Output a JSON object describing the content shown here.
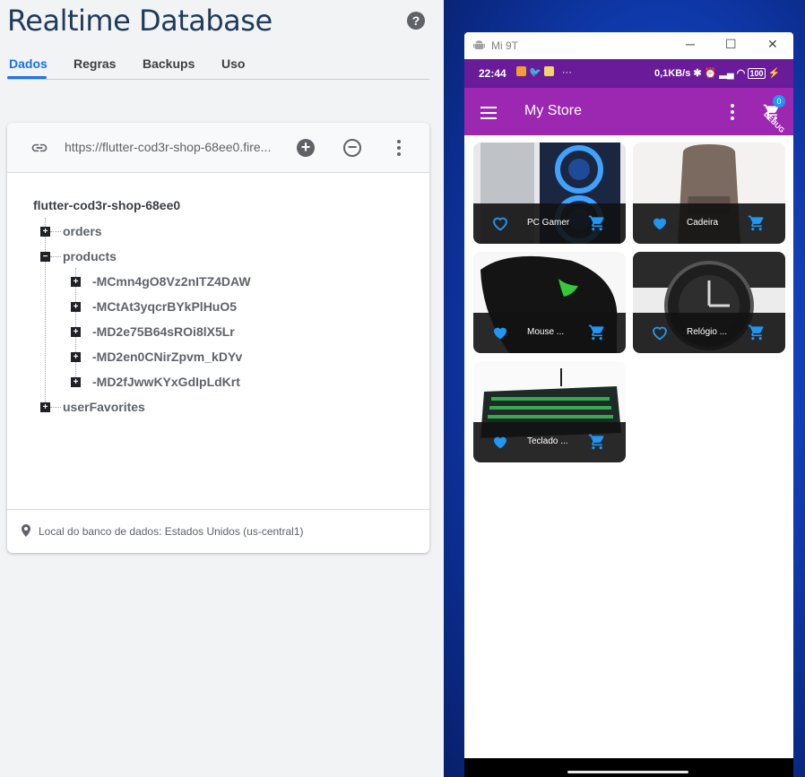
{
  "console": {
    "title": "Realtime Database",
    "help_icon": "help-icon",
    "tabs": [
      {
        "label": "Dados",
        "active": true
      },
      {
        "label": "Regras",
        "active": false
      },
      {
        "label": "Backups",
        "active": false
      },
      {
        "label": "Uso",
        "active": false
      }
    ],
    "url": "https://flutter-cod3r-shop-68ee0.fire...",
    "tree": {
      "root": "flutter-cod3r-shop-68ee0",
      "nodes": [
        {
          "label": "orders",
          "expanded": false
        },
        {
          "label": "products",
          "expanded": true,
          "children": [
            "-MCmn4gO8Vz2nITZ4DAW",
            "-MCtAt3yqcrBYkPlHuO5",
            "-MD2e75B64sROi8lX5Lr",
            "-MD2en0CNirZpvm_kDYv",
            "-MD2fJwwKYxGdIpLdKrt"
          ]
        },
        {
          "label": "userFavorites",
          "expanded": false
        }
      ]
    },
    "footer": "Local do banco de dados: Estados Unidos (us-central1)"
  },
  "emulator": {
    "window_title": "Mi 9T",
    "window_buttons": [
      "─",
      "☐",
      "✕"
    ],
    "status": {
      "time": "22:44",
      "net": "0,1KB/s",
      "battery": "100"
    },
    "appbar": {
      "title": "My Store",
      "cart_count": "0",
      "debug": "DEBUG"
    },
    "products": [
      {
        "label": "PC Gamer",
        "favorite": false
      },
      {
        "label": "Cadeira",
        "favorite": true
      },
      {
        "label": "Mouse ...",
        "favorite": true
      },
      {
        "label": "Relógio ...",
        "favorite": false
      },
      {
        "label": "Teclado ...",
        "favorite": true
      }
    ],
    "colors": {
      "statusbar": "#6a1b9a",
      "appbar": "#9c27b0",
      "accent": "#2196f3"
    }
  }
}
